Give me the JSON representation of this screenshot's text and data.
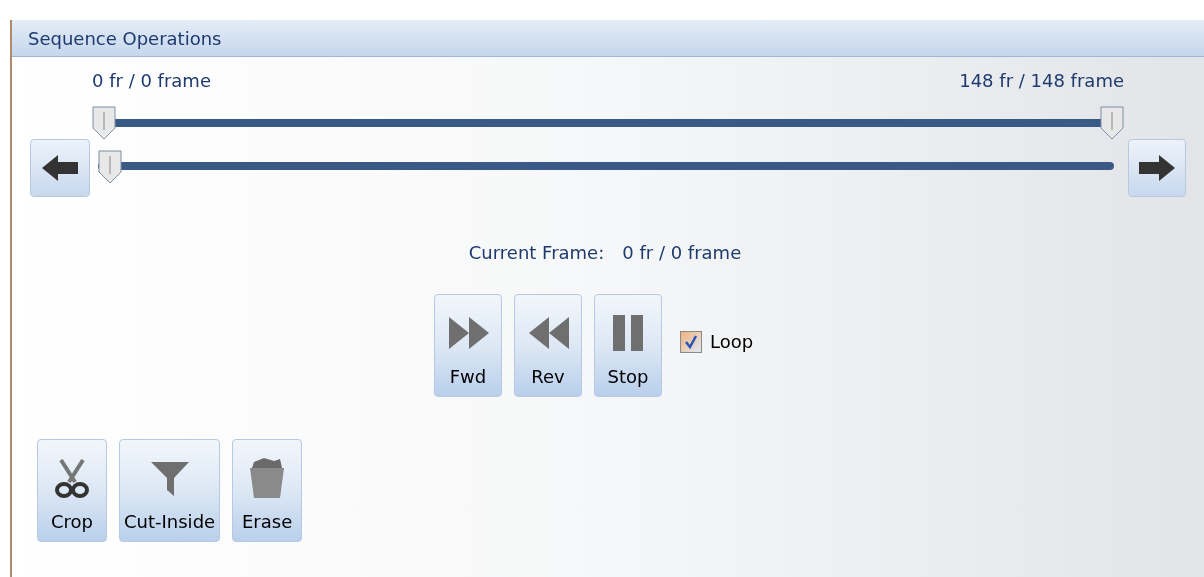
{
  "panel": {
    "title": "Sequence Operations"
  },
  "range_slider": {
    "thumbs": [
      {
        "label": "0 fr / 0 frame",
        "level": 0
      },
      {
        "label": "148 fr / 148 frame",
        "level": 1
      }
    ]
  },
  "position_slider": {
    "level": 0
  },
  "current_frame": {
    "label": "Current Frame:",
    "value": "0 fr / 0 frame"
  },
  "playback_buttons": [
    {
      "kind": "fwd",
      "label": "Fwd"
    },
    {
      "kind": "rev",
      "label": "Rev"
    },
    {
      "kind": "stop",
      "label": "Stop"
    }
  ],
  "loop": {
    "label": "Loop",
    "checked": true
  },
  "edit_buttons": [
    {
      "kind": "crop",
      "label": "Crop"
    },
    {
      "kind": "cut",
      "label": "Cut-Inside"
    },
    {
      "kind": "erase",
      "label": "Erase"
    }
  ]
}
